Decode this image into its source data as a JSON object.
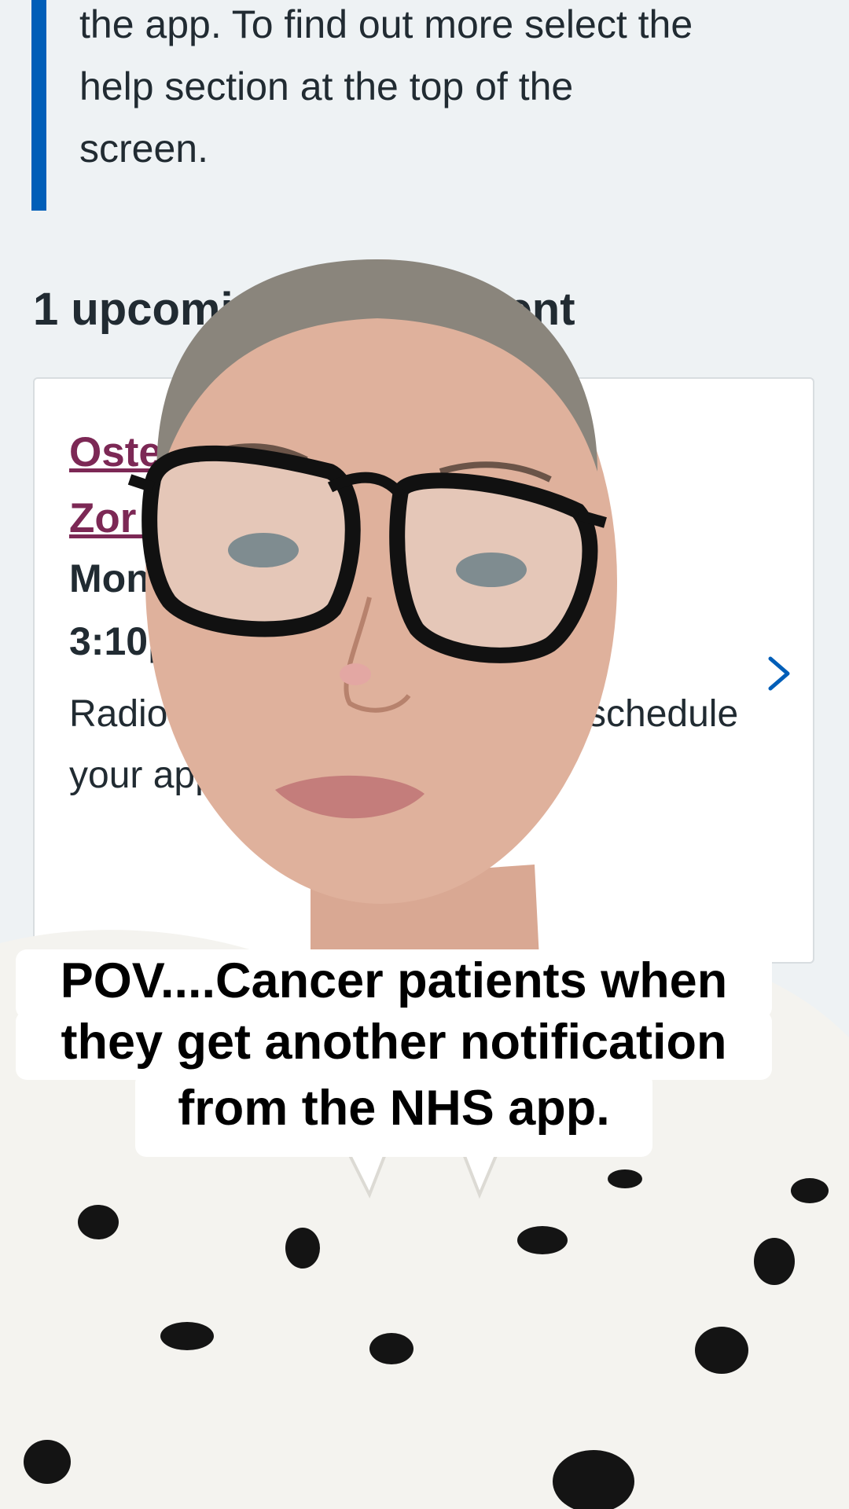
{
  "info_callout": {
    "text": "the app. To find out more select the\nhelp section at the top of the\nscreen."
  },
  "appointments": {
    "heading": "1 upcoming appointment",
    "card": {
      "title": "Oste                      e\nZor                         ent",
      "date_time": "Mon\n3:10p",
      "description": "Radio                          ease refer                           rther details                         eschedule your app"
    }
  },
  "icons": {
    "chevron": "chevron-right-icon"
  },
  "caption": {
    "line1": "POV....Cancer patients when",
    "line2": "they get another notification",
    "line3": "from the NHS app."
  },
  "colors": {
    "nhs_blue": "#005eb8",
    "link_purple": "#7c2855",
    "text_dark": "#212b32",
    "page_bg": "#eef2f4"
  }
}
